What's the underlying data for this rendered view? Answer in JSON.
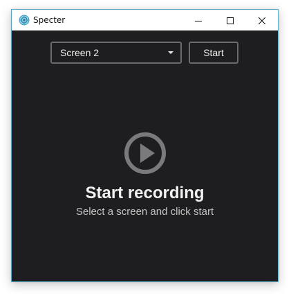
{
  "window": {
    "title": "Specter",
    "app_icon": "specter-logo-icon",
    "controls": {
      "minimize_icon": "minimize-icon",
      "maximize_icon": "maximize-icon",
      "close_icon": "close-icon"
    }
  },
  "toolbar": {
    "screen_select": {
      "selected": "Screen 2"
    },
    "start_label": "Start"
  },
  "empty_state": {
    "icon": "play-circle-icon",
    "heading": "Start recording",
    "message": "Select a screen and click start"
  },
  "colors": {
    "background": "#1e1e20",
    "border": "#6b6b6e",
    "icon": "#7a7a7d",
    "text": "#f2f2f2",
    "subtext": "#c4c4c4",
    "window_border": "#59a6c4"
  }
}
